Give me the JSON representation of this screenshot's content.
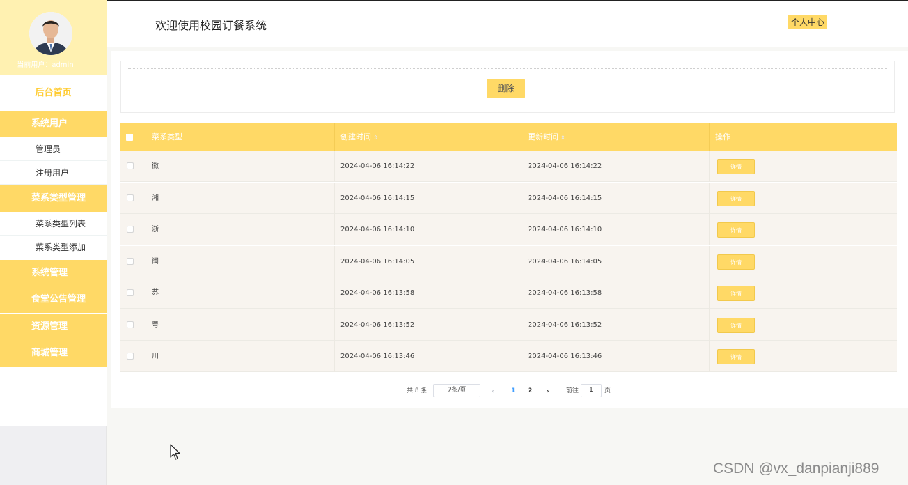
{
  "sidebar": {
    "user_label": "当前用户：admin",
    "home": "后台首页",
    "groups": {
      "system_user": "系统用户",
      "dish_type": "菜系类型管理",
      "system_manage": "系统管理",
      "canteen_notice": "食堂公告管理",
      "resource": "资源管理",
      "mall": "商城管理"
    },
    "subs": {
      "admin": "管理员",
      "registered": "注册用户",
      "dish_type_list": "菜系类型列表",
      "dish_type_add": "菜系类型添加"
    }
  },
  "header": {
    "title": "欢迎使用校园订餐系统",
    "profile_link": "个人中心"
  },
  "actions": {
    "delete": "删除"
  },
  "table": {
    "columns": [
      "菜系类型",
      "创建时间",
      "更新时间",
      "操作"
    ],
    "sort_icon": "⇕",
    "detail_label": "详情",
    "rows": [
      {
        "type": "徽",
        "created": "2024-04-06 16:14:22",
        "updated": "2024-04-06 16:14:22"
      },
      {
        "type": "湘",
        "created": "2024-04-06 16:14:15",
        "updated": "2024-04-06 16:14:15"
      },
      {
        "type": "浙",
        "created": "2024-04-06 16:14:10",
        "updated": "2024-04-06 16:14:10"
      },
      {
        "type": "闽",
        "created": "2024-04-06 16:14:05",
        "updated": "2024-04-06 16:14:05"
      },
      {
        "type": "苏",
        "created": "2024-04-06 16:13:58",
        "updated": "2024-04-06 16:13:58"
      },
      {
        "type": "粤",
        "created": "2024-04-06 16:13:52",
        "updated": "2024-04-06 16:13:52"
      },
      {
        "type": "川",
        "created": "2024-04-06 16:13:46",
        "updated": "2024-04-06 16:13:46"
      }
    ]
  },
  "pagination": {
    "total": "共 8 条",
    "page_size": "7条/页",
    "prev": "‹",
    "pages": [
      "1",
      "2"
    ],
    "next": "›",
    "goto_label": "前往",
    "goto_value": "1",
    "goto_suffix": "页"
  },
  "watermark": "CSDN @vx_danpianji889",
  "colors": {
    "accent": "#ffd966",
    "profile_bg": "#fff1b1",
    "row_bg": "#f8f4ef",
    "active_page": "#409eff"
  }
}
